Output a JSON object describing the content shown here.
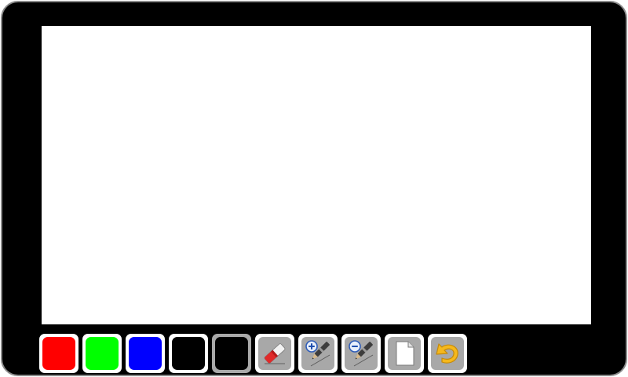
{
  "app": {
    "frame_color": "#000000",
    "bezel_color": "#8a8a8a",
    "canvas_color": "#ffffff"
  },
  "toolbar": {
    "colors": [
      {
        "name": "red",
        "hex": "#ff0000",
        "selected": false
      },
      {
        "name": "green",
        "hex": "#00ff00",
        "selected": false
      },
      {
        "name": "blue",
        "hex": "#0000ff",
        "selected": false
      },
      {
        "name": "black",
        "hex": "#000000",
        "selected": false
      },
      {
        "name": "black",
        "hex": "#000000",
        "selected": true
      }
    ],
    "tools": [
      {
        "icon": "eraser-icon"
      },
      {
        "icon": "pen-size-increase-icon"
      },
      {
        "icon": "pen-size-decrease-icon"
      },
      {
        "icon": "new-page-icon"
      },
      {
        "icon": "undo-icon"
      }
    ]
  }
}
